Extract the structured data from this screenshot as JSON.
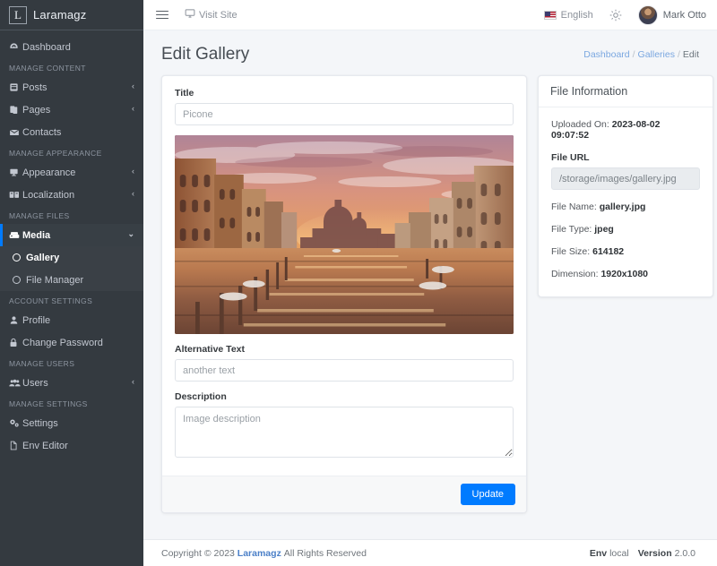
{
  "brand": {
    "logo_letter": "L",
    "name": "Laramagz"
  },
  "sidebar": {
    "groups": [
      {
        "header": null,
        "items": [
          {
            "label": "Dashboard",
            "icon": "dashboard-icon",
            "arrow": null
          }
        ]
      },
      {
        "header": "MANAGE CONTENT",
        "items": [
          {
            "label": "Posts",
            "icon": "posts-icon",
            "arrow": "‹"
          },
          {
            "label": "Pages",
            "icon": "pages-icon",
            "arrow": "‹"
          },
          {
            "label": "Contacts",
            "icon": "contacts-icon",
            "arrow": null
          }
        ]
      },
      {
        "header": "MANAGE APPEARANCE",
        "items": [
          {
            "label": "Appearance",
            "icon": "appearance-icon",
            "arrow": "‹"
          },
          {
            "label": "Localization",
            "icon": "localization-icon",
            "arrow": "‹"
          }
        ]
      },
      {
        "header": "MANAGE FILES",
        "items": [
          {
            "label": "Media",
            "icon": "media-icon",
            "arrow": "⌄",
            "open": true,
            "children": [
              {
                "label": "Gallery",
                "active": true
              },
              {
                "label": "File Manager",
                "active": false
              }
            ]
          }
        ]
      },
      {
        "header": "ACCOUNT SETTINGS",
        "items": [
          {
            "label": "Profile",
            "icon": "profile-icon",
            "arrow": null
          },
          {
            "label": "Change Password",
            "icon": "lock-icon",
            "arrow": null
          }
        ]
      },
      {
        "header": "MANAGE USERS",
        "items": [
          {
            "label": "Users",
            "icon": "users-icon",
            "arrow": "‹"
          }
        ]
      },
      {
        "header": "MANAGE SETTINGS",
        "items": [
          {
            "label": "Settings",
            "icon": "settings-icon",
            "arrow": null
          },
          {
            "label": "Env Editor",
            "icon": "file-icon",
            "arrow": null
          }
        ]
      }
    ]
  },
  "topbar": {
    "menu_icon": "hamburger-icon",
    "visit_site": "Visit Site",
    "language": "English",
    "language_flag": "us-flag-icon",
    "brightness_icon": "sun-icon",
    "user_name": "Mark Otto"
  },
  "page": {
    "title": "Edit Gallery",
    "breadcrumb": {
      "items": [
        "Dashboard",
        "Galleries"
      ],
      "current": "Edit",
      "separator": "/"
    }
  },
  "form": {
    "title_label": "Title",
    "title_placeholder": "Picone",
    "title_value": "",
    "alt_label": "Alternative Text",
    "alt_placeholder": "another text",
    "alt_value": "",
    "description_label": "Description",
    "description_placeholder": "Image description",
    "description_value": "",
    "update_button": "Update",
    "image_alt": "venice-grand-canal-sunset-photo"
  },
  "file_information": {
    "header": "File Information",
    "uploaded_on_label": "Uploaded On:",
    "uploaded_on_value": "2023-08-02 09:07:52",
    "file_url_label": "File URL",
    "file_url_value": "/storage/images/gallery.jpg",
    "file_name_label": "File Name:",
    "file_name_value": "gallery.jpg",
    "file_type_label": "File Type:",
    "file_type_value": "jpeg",
    "file_size_label": "File Size:",
    "file_size_value": "614182",
    "dimension_label": "Dimension:",
    "dimension_value": "1920x1080"
  },
  "footer": {
    "copyright": "Copyright © 2023",
    "brand": "Laramagz",
    "rights": "All Rights Reserved",
    "env_label": "Env",
    "env_value": "local",
    "version_label": "Version",
    "version_value": "2.0.0"
  },
  "colors": {
    "accent": "#007bff",
    "sidebar_bg": "#343a40",
    "link": "#7aa7e0",
    "brand_link": "#4c80c8"
  }
}
